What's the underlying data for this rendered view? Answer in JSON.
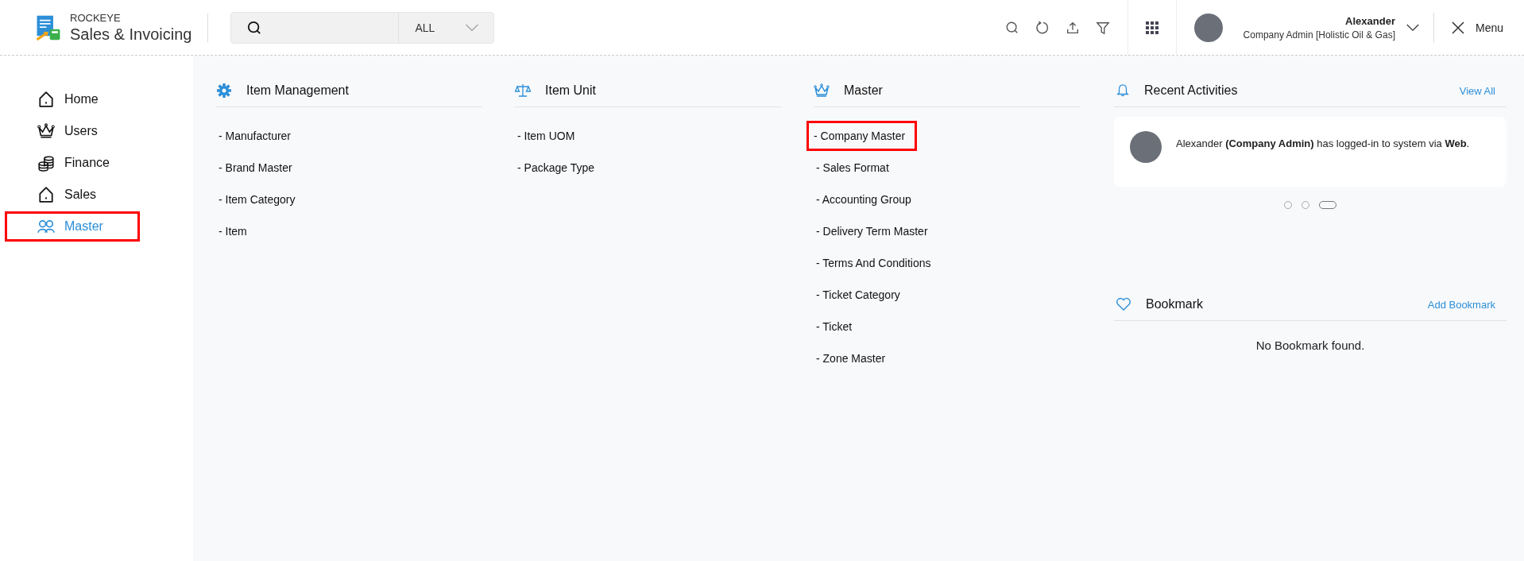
{
  "header": {
    "brand_top": "ROCKEYE",
    "brand_name": "Sales & Invoicing",
    "search": {
      "scope": "ALL"
    },
    "user": {
      "name": "Alexander",
      "role": "Company Admin [Holistic Oil & Gas]"
    },
    "menu_label": "Menu"
  },
  "sidebar": {
    "items": [
      {
        "label": "Home",
        "selected": false,
        "highlighted": false
      },
      {
        "label": "Users",
        "selected": false,
        "highlighted": false
      },
      {
        "label": "Finance",
        "selected": false,
        "highlighted": false
      },
      {
        "label": "Sales",
        "selected": false,
        "highlighted": false
      },
      {
        "label": "Master",
        "selected": true,
        "highlighted": true
      }
    ]
  },
  "menu_columns": [
    {
      "title": "Item Management",
      "items": [
        {
          "label": "- Manufacturer",
          "highlighted": false
        },
        {
          "label": "- Brand Master",
          "highlighted": false
        },
        {
          "label": "- Item Category",
          "highlighted": false
        },
        {
          "label": "- Item",
          "highlighted": false
        }
      ]
    },
    {
      "title": "Item Unit",
      "items": [
        {
          "label": "- Item UOM",
          "highlighted": false
        },
        {
          "label": "- Package Type",
          "highlighted": false
        }
      ]
    },
    {
      "title": "Master",
      "items": [
        {
          "label": "- Company Master",
          "highlighted": true
        },
        {
          "label": "- Sales Format",
          "highlighted": false
        },
        {
          "label": "- Accounting Group",
          "highlighted": false
        },
        {
          "label": "- Delivery Term Master",
          "highlighted": false
        },
        {
          "label": "- Terms And Conditions",
          "highlighted": false
        },
        {
          "label": "- Ticket Category",
          "highlighted": false
        },
        {
          "label": "- Ticket",
          "highlighted": false
        },
        {
          "label": "- Zone Master",
          "highlighted": false
        }
      ]
    }
  ],
  "recent_activities": {
    "title": "Recent Activities",
    "link": "View All",
    "items": [
      {
        "message": "Alexander **(Company Admin)** has logged-in to system via **Web**."
      }
    ],
    "carousel": [
      {
        "selected": false
      },
      {
        "selected": false
      },
      {
        "selected": true
      }
    ]
  },
  "bookmark": {
    "title": "Bookmark",
    "link": "Add Bookmark",
    "empty_text": "No Bookmark found."
  }
}
